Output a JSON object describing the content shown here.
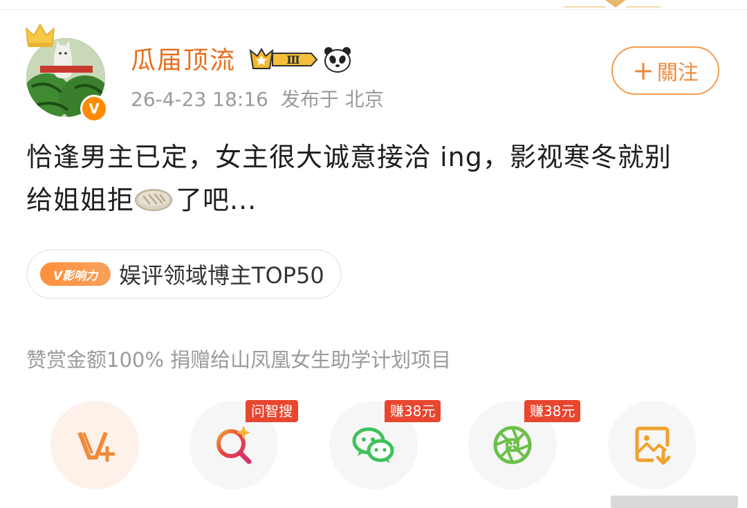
{
  "user": {
    "name": "瓜届顶流",
    "member_level": "Ⅲ",
    "post_time": "26-4-23 18:16",
    "location": "发布于 北京",
    "follow_plus": "+",
    "follow_label": "關注"
  },
  "post": {
    "line1": "恰逢男主已定，女主很大诚意接洽 ing，影视寒冬就别",
    "line2_before": "给姐姐拒",
    "line2_after": "了吧...",
    "inline_emoji": "pancake-emoji"
  },
  "influence": {
    "tag": "V影响力",
    "label": "娱评领域博主TOP50"
  },
  "reward_note": "赞赏金额100% 捐赠给山凤凰女生助学计划项目",
  "actions": {
    "tag_ask": "问智搜",
    "tag_wechat": "赚38元",
    "tag_moments": "赚38元"
  },
  "colors": {
    "accent_orange": "#e86e1c",
    "tag_red": "#e8462f",
    "wechat_green": "#3ec15a",
    "moments_green": "#6bc04a"
  }
}
